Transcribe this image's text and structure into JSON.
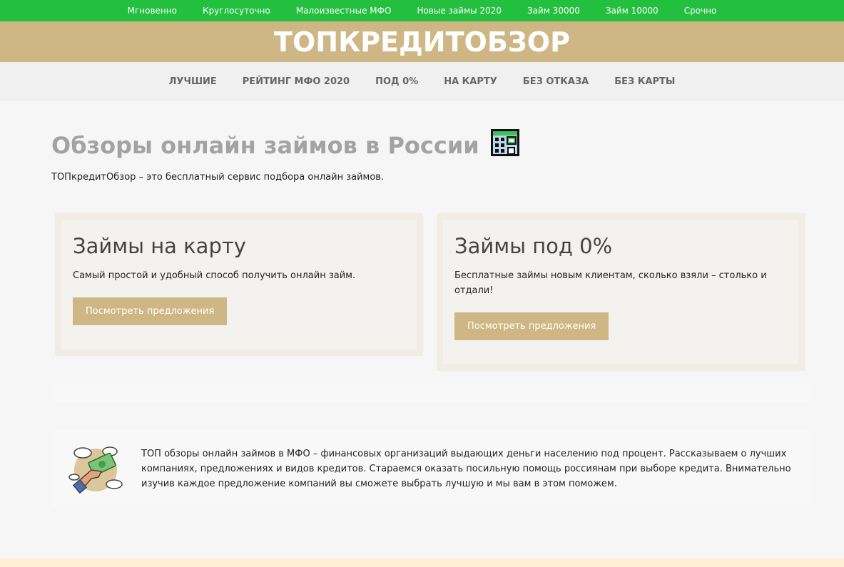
{
  "topnav": {
    "items": [
      "Мгновенно",
      "Круглосуточно",
      "Малоизвестные МФО",
      "Новые займы 2020",
      "Займ 30000",
      "Займ 10000",
      "Срочно"
    ]
  },
  "brand": {
    "title": "ТОПКРЕДИТОБЗОР"
  },
  "mainnav": {
    "items": [
      "ЛУЧШИЕ",
      "РЕЙТИНГ МФО 2020",
      "ПОД 0%",
      "НА КАРТУ",
      "БЕЗ ОТКАЗА",
      "БЕЗ КАРТЫ"
    ]
  },
  "hero": {
    "title": "Обзоры онлайн займов в России",
    "icon": "bank-building-icon",
    "lead": "ТОПкредитОбзор – это бесплатный сервис подбора онлайн займов."
  },
  "cards": [
    {
      "title": "Займы на карту",
      "text": "Самый простой и удобный способ получить онлайн займ.",
      "button": "Посмотреть предложения"
    },
    {
      "title": "Займы под 0%",
      "text": "Бесплатные займы новым клиентам, сколько взяли – столько и отдали!",
      "button": "Посмотреть предложения"
    }
  ],
  "info": {
    "illustration": "hand-with-money-illustration",
    "text": "ТОП обзоры онлайн займов в МФО – финансовых организаций выдающих деньги населению под процент. Рассказываем о лучших компаниях, предложениях и видов кредитов. Стараемся оказать посильную помощь россиянам при выборе кредита. Внимательно изучив каждое предложение компаний вы сможете выбрать лучшую и мы вам в этом поможем."
  },
  "colors": {
    "topbar": "#23bf3f",
    "brand": "#cfb785",
    "button": "#cfb785",
    "heading_gray": "#a3a3a3"
  }
}
